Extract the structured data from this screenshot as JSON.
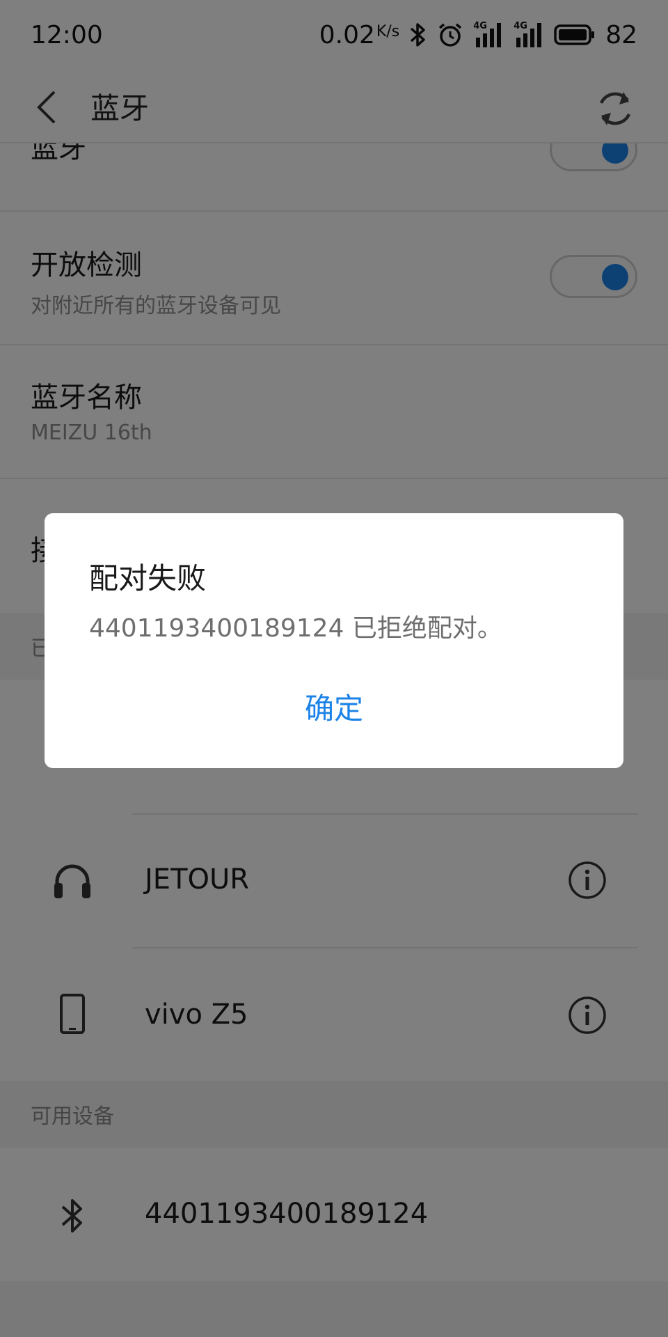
{
  "status_bar": {
    "time": "12:00",
    "net_speed": "0.02",
    "net_speed_unit": "K/s",
    "battery_level": "82",
    "network_label_1": "4G",
    "network_label_2": "4G"
  },
  "app_bar": {
    "title": "蓝牙"
  },
  "settings": {
    "bluetooth_label": "蓝牙",
    "open_detection_title": "开放检测",
    "open_detection_sub": "对附近所有的蓝牙设备可见",
    "device_name_title": "蓝牙名称",
    "device_name_value": "MEIZU 16th",
    "received_files_prefix": "接",
    "paired_header_prefix": "已"
  },
  "paired_devices": [
    {
      "name": "JETOUR",
      "icon": "headphones-icon"
    },
    {
      "name": "vivo Z5",
      "icon": "phone-icon"
    }
  ],
  "available_header": "可用设备",
  "available_devices": [
    {
      "name": "4401193400189124",
      "icon": "bluetooth-icon"
    }
  ],
  "dialog": {
    "title": "配对失败",
    "message": "4401193400189124 已拒绝配对。",
    "confirm_label": "确定"
  },
  "colors": {
    "accent": "#1b82e8",
    "scrim": "rgba(0,0,0,0.5)"
  }
}
